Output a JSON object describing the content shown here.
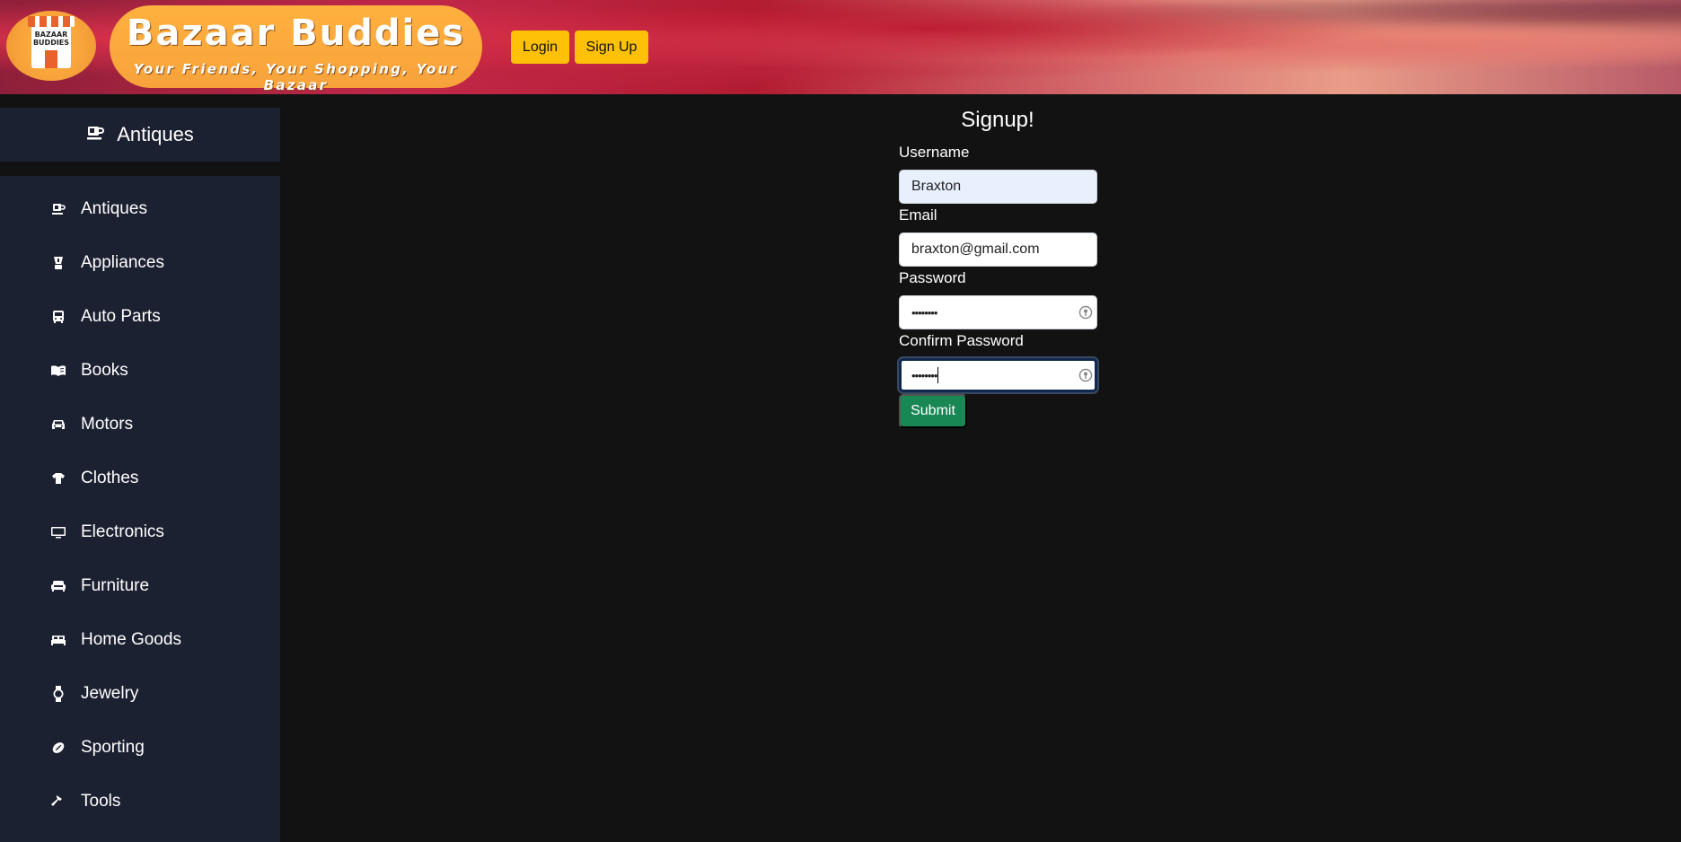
{
  "header": {
    "logo_text": [
      "BAZAAR",
      "BUDDIES"
    ],
    "brand_title": "Bazaar Buddies",
    "brand_tagline": "Your Friends, Your Shopping, Your Bazaar",
    "login_label": "Login",
    "signup_label": "Sign Up",
    "brand_color": "#f7a23b",
    "button_color": "#ffc107"
  },
  "sidebar": {
    "current_category": "Antiques",
    "current_icon": "coffee-cup-icon",
    "items": [
      {
        "label": "Antiques",
        "icon": "coffee-cup-icon"
      },
      {
        "label": "Appliances",
        "icon": "blender-icon"
      },
      {
        "label": "Auto Parts",
        "icon": "bus-icon"
      },
      {
        "label": "Books",
        "icon": "open-book-icon"
      },
      {
        "label": "Motors",
        "icon": "car-icon"
      },
      {
        "label": "Clothes",
        "icon": "shirt-icon"
      },
      {
        "label": "Electronics",
        "icon": "monitor-icon"
      },
      {
        "label": "Furniture",
        "icon": "couch-icon"
      },
      {
        "label": "Home Goods",
        "icon": "bed-icon"
      },
      {
        "label": "Jewelry",
        "icon": "watch-icon"
      },
      {
        "label": "Sporting",
        "icon": "football-icon"
      },
      {
        "label": "Tools",
        "icon": "hammer-icon"
      }
    ]
  },
  "form": {
    "title": "Signup!",
    "username_label": "Username",
    "username_value": "Braxton",
    "email_label": "Email",
    "email_value": "braxton@gmail.com",
    "password_label": "Password",
    "password_value": "••••••••",
    "confirm_label": "Confirm Password",
    "confirm_value": "••••••••",
    "submit_label": "Submit",
    "submit_color": "#198754"
  }
}
